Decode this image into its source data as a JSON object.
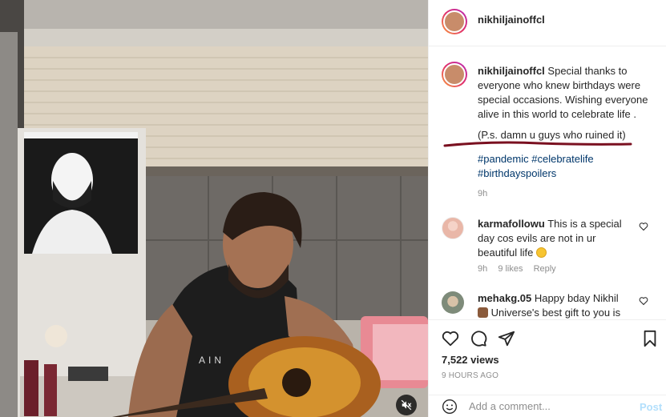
{
  "post": {
    "username": "nikhiljainoffcl",
    "caption": {
      "username": "nikhiljainoffcl",
      "text": "Special thanks to everyone who knew birthdays were special occasions. Wishing everyone alive in this world to celebrate life .",
      "ps": "(P.s. damn u guys who ruined it)",
      "hashtags": [
        "#pandemic",
        "#celebratelife",
        "#birthdayspoilers"
      ],
      "time": "9h"
    },
    "comments": [
      {
        "username": "karmafollowu",
        "text": "This is a special day cos evils are not in ur beautiful life",
        "time": "9h",
        "likes": "9 likes",
        "reply": "Reply"
      },
      {
        "username": "mehakg.05",
        "text": "Happy bday Nikhil",
        "text2": "Universe's best gift to you is"
      }
    ],
    "views": "7,522 views",
    "timestamp": "9 HOURS AGO",
    "add_comment_placeholder": "Add a comment...",
    "post_label": "Post"
  },
  "icons": {
    "like": "heart-icon",
    "comment": "comment-icon",
    "share": "paper-plane-icon",
    "save": "bookmark-icon",
    "mute": "speaker-muted-icon",
    "emoji": "smiley-icon"
  },
  "colors": {
    "hashtag": "#00376b",
    "secondary_text": "#8e8e8e",
    "underline_annotation": "#7a1020",
    "post_disabled": "#b2dffc"
  }
}
